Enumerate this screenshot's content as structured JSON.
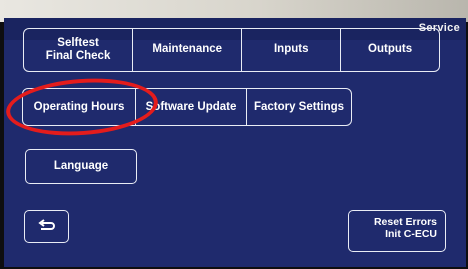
{
  "header": {
    "title": "Service"
  },
  "tabs": [
    {
      "label": "Selftest\nFinal Check"
    },
    {
      "label": "Maintenance"
    },
    {
      "label": "Inputs"
    },
    {
      "label": "Outputs"
    }
  ],
  "row2": [
    {
      "label": "Operating Hours"
    },
    {
      "label": "Software Update"
    },
    {
      "label": "Factory Settings"
    }
  ],
  "language_button": {
    "label": "Language"
  },
  "reset_button": {
    "label": "Reset Errors\nInit C-ECU"
  },
  "back_button": {
    "icon": "return-arrow-icon"
  },
  "annotation": {
    "color": "#e41c1c"
  }
}
